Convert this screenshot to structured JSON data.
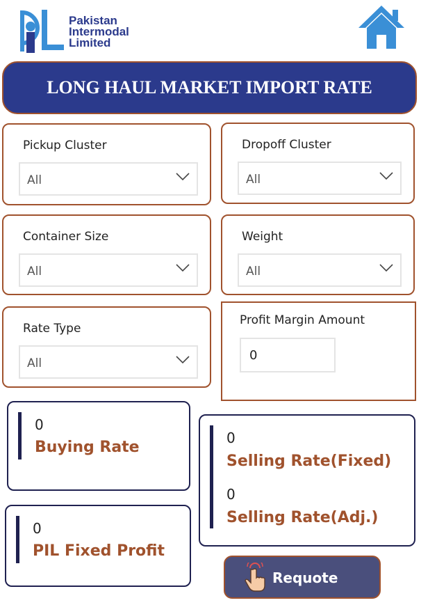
{
  "header": {
    "logo_line1": "Pakistan",
    "logo_line2": "Intermodal",
    "logo_line3": "Limited",
    "title": "LONG HAUL MARKET IMPORT RATE",
    "home_icon": "home-icon"
  },
  "filters": {
    "pickup_cluster": {
      "label": "Pickup Cluster",
      "value": "All"
    },
    "dropoff_cluster": {
      "label": "Dropoff Cluster",
      "value": "All"
    },
    "container_size": {
      "label": "Container Size",
      "value": "All"
    },
    "weight": {
      "label": "Weight",
      "value": "All"
    },
    "rate_type": {
      "label": "Rate Type",
      "value": "All"
    },
    "profit_margin": {
      "label": "Profit Margin Amount",
      "value": "0"
    }
  },
  "kpis": {
    "buying_rate": {
      "value": "0",
      "label": "Buying Rate"
    },
    "selling_fixed": {
      "value": "0",
      "label": "Selling Rate(Fixed)"
    },
    "selling_adj": {
      "value": "0",
      "label": "Selling Rate(Adj.)"
    },
    "pil_fixed_profit": {
      "value": "0",
      "label": "PIL Fixed Profit"
    }
  },
  "actions": {
    "requote_label": "Requote",
    "requote_icon": "hand-pointer-icon"
  },
  "colors": {
    "navy": "#2b3a8c",
    "accent_brown": "#a0522d",
    "dark_navy": "#1f2150",
    "sky_blue": "#3a8fd6"
  }
}
